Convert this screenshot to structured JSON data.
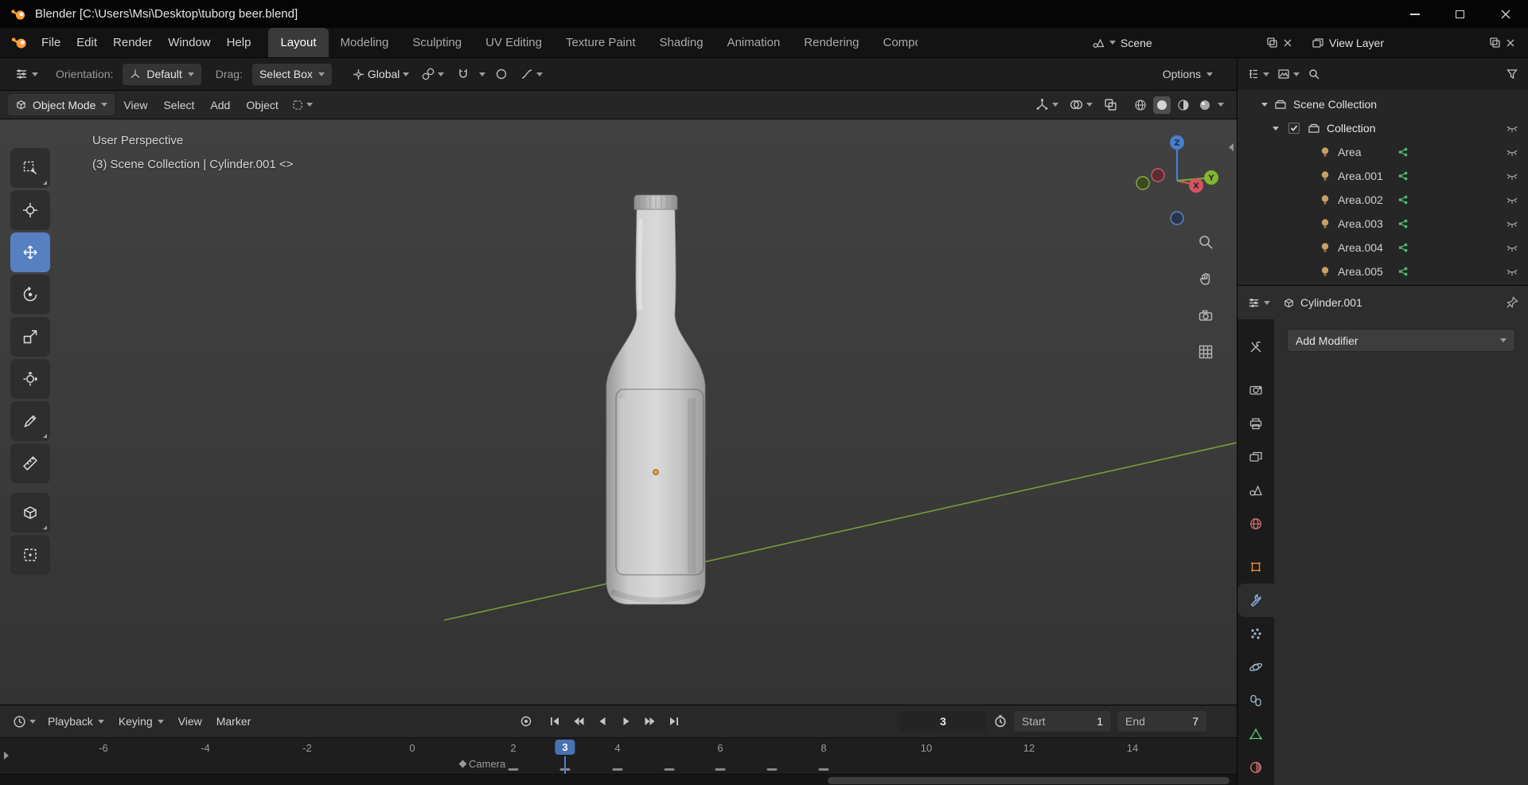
{
  "window": {
    "title": "Blender [C:\\Users\\Msi\\Desktop\\tuborg beer.blend]"
  },
  "topbar": {
    "menus": [
      "File",
      "Edit",
      "Render",
      "Window",
      "Help"
    ],
    "tabs": [
      "Layout",
      "Modeling",
      "Sculpting",
      "UV Editing",
      "Texture Paint",
      "Shading",
      "Animation",
      "Rendering",
      "Compositing"
    ],
    "scene_selector": {
      "value": "Scene"
    },
    "view_layer_selector": {
      "value": "View Layer"
    }
  },
  "tool_settings": {
    "orientation_label": "Orientation:",
    "orientation_value": "Default",
    "drag_label": "Drag:",
    "drag_value": "Select Box",
    "pivot_value": "Global",
    "options_label": "Options"
  },
  "viewport_header": {
    "mode": "Object Mode",
    "menus": [
      "View",
      "Select",
      "Add",
      "Object"
    ]
  },
  "viewport": {
    "overlay_line1": "User Perspective",
    "overlay_line2": "(3) Scene Collection | Cylinder.001 <>",
    "axis_labels": {
      "x": "X",
      "y": "Y",
      "z": "Z"
    }
  },
  "outliner": {
    "root": "Scene Collection",
    "collection": "Collection",
    "items": [
      "Area",
      "Area.001",
      "Area.002",
      "Area.003",
      "Area.004",
      "Area.005"
    ]
  },
  "properties": {
    "breadcrumb_object": "Cylinder.001",
    "add_modifier_label": "Add Modifier"
  },
  "timeline": {
    "menus": [
      "Playback",
      "Keying",
      "View",
      "Marker"
    ],
    "current_frame": "3",
    "start_label": "Start",
    "start_value": "1",
    "end_label": "End",
    "end_value": "7",
    "marker_label": "Camera",
    "ruler_labels": [
      "-6",
      "-4",
      "-2",
      "0",
      "2",
      "4",
      "6",
      "8",
      "10",
      "12",
      "14"
    ]
  },
  "colors": {
    "accent_blue": "#4772b3",
    "selection_orange": "#e87d0d",
    "axis_x": "#d8525f",
    "axis_y": "#83b52e",
    "axis_z": "#477fd0",
    "y_axis_line": "#7ba33b"
  },
  "icons": {
    "blender-logo-icon": "orange-circle-with-white-dot",
    "caret-down-icon": "css-triangle",
    "search-icon": "magnifier",
    "filter-icon": "funnel",
    "eye-closed-icon": "curved-line",
    "light-icon": "bulb",
    "nodes-icon": "green-node-dots",
    "checkbox-checked-icon": "checkmark",
    "pin-icon": "pushpin",
    "clock-icon": "clock",
    "magnet-icon": "magnet-u",
    "chain-icon": "chain-links",
    "camera-icon": "camera",
    "hand-icon": "pan-hand",
    "zoom-icon": "magnifier",
    "grid-icon": "ortho-grid",
    "navigation-gizmo": "axis-balls"
  }
}
